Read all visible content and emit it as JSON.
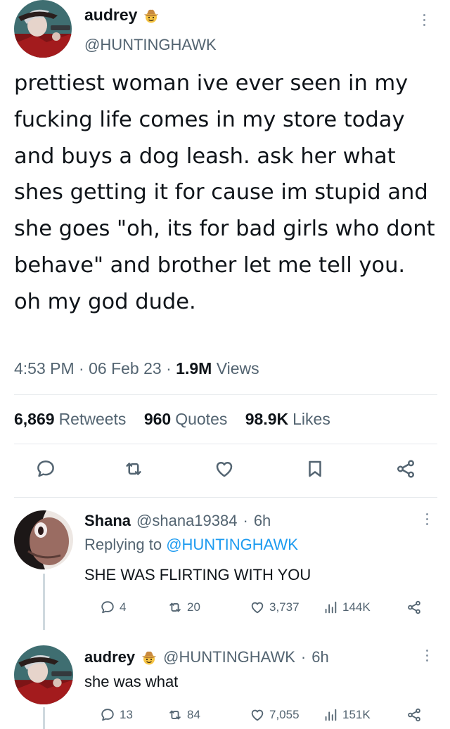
{
  "main_tweet": {
    "display_name": "audrey",
    "name_emoji": "cowboy-emoji",
    "handle": "@HUNTINGHAWK",
    "text": "prettiest woman ive ever seen in my fucking life comes in my store today and buys a dog leash. ask her what shes getting it for cause im stupid and she goes \"oh, its for bad girls who dont behave\" and brother let me tell you. oh my god dude.",
    "time": "4:53 PM",
    "date": "06 Feb 23",
    "views_count": "1.9M",
    "views_label": "Views",
    "retweets_count": "6,869",
    "retweets_label": "Retweets",
    "quotes_count": "960",
    "quotes_label": "Quotes",
    "likes_count": "98.9K",
    "likes_label": "Likes",
    "actions": [
      "reply-icon",
      "retweet-icon",
      "like-icon",
      "bookmark-icon",
      "share-icon"
    ]
  },
  "replies": [
    {
      "display_name": "Shana",
      "handle": "@shana19384",
      "age": "6h",
      "replying_prefix": "Replying to",
      "replying_to": "@HUNTINGHAWK",
      "text": "SHE WAS FLIRTING WITH YOU",
      "reply_count": "4",
      "retweet_count": "20",
      "like_count": "3,737",
      "view_count": "144K"
    },
    {
      "display_name": "audrey",
      "name_emoji": "cowboy-emoji",
      "handle": "@HUNTINGHAWK",
      "age": "6h",
      "text": "she was what",
      "reply_count": "13",
      "retweet_count": "84",
      "like_count": "7,055",
      "view_count": "151K"
    }
  ],
  "separator": "·",
  "colors": {
    "text": "#0f1419",
    "secondary": "#536471",
    "accent": "#1d9bf0",
    "divider": "#e6e9ec"
  }
}
